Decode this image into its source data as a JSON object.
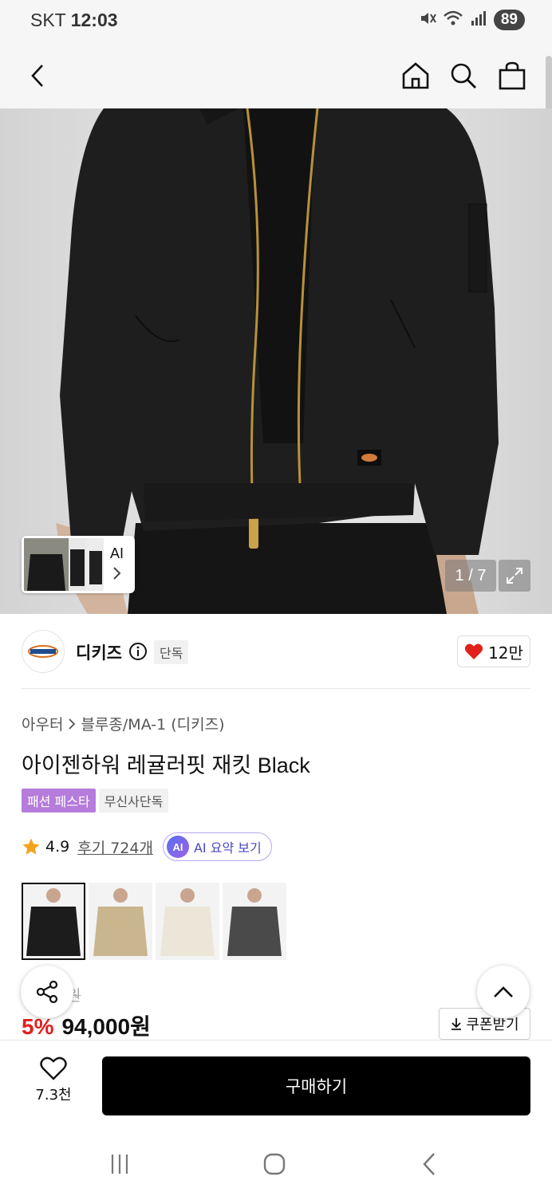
{
  "status_bar": {
    "carrier": "SKT",
    "time": "12:03",
    "battery": "89"
  },
  "hero": {
    "page_counter": "1 / 7",
    "ai_label": "AI"
  },
  "brand": {
    "name": "디키즈",
    "badge": "단독",
    "like_count": "12만"
  },
  "product": {
    "breadcrumb": [
      "아우터",
      "블루종/MA-1 (디키즈)"
    ],
    "title": "아이젠하워 레귤러핏 재킷 Black",
    "tags": [
      "패션 페스타",
      "무신사단독"
    ],
    "rating": "4.9",
    "reviews": "후기 724개",
    "ai_summary": "AI 요약 보기",
    "ai_badge": "AI",
    "colors": [
      {
        "name": "black",
        "hex": "#1c1c1c",
        "selected": true
      },
      {
        "name": "khaki",
        "hex": "#c9b58e",
        "selected": false
      },
      {
        "name": "cream",
        "hex": "#ece6d8",
        "selected": false
      },
      {
        "name": "charcoal",
        "hex": "#4a4a4a",
        "selected": false
      }
    ]
  },
  "price": {
    "old_price_visible": "원",
    "discount": "5%",
    "current": "94,000원",
    "coupon": "쿠폰받기"
  },
  "bottom": {
    "wish_count": "7.3천",
    "buy": "구매하기"
  },
  "colors": {
    "discount_red": "#e02020",
    "festa_purple": "#b57cdb",
    "ai_purple": "#4a46c8",
    "heart_red": "#e0201c"
  }
}
